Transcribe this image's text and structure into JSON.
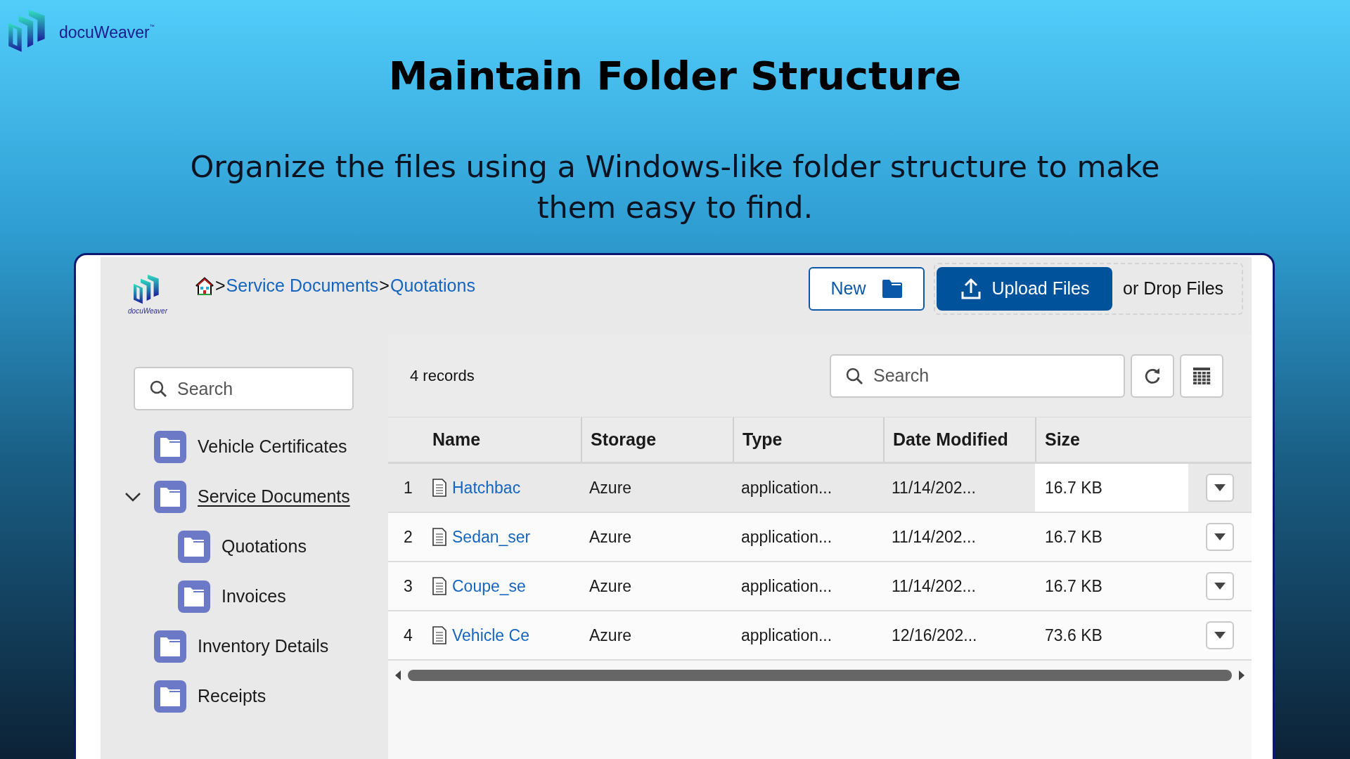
{
  "brand": {
    "name": "docuWeaver",
    "mark": "™"
  },
  "headline": "Maintain Folder Structure",
  "subheadline": "Organize the files using a Windows-like folder structure to make them easy to find.",
  "app": {
    "logo_text": "docuWeaver",
    "breadcrumb": [
      {
        "label": "Service Documents"
      },
      {
        "label": "Quotations"
      }
    ],
    "breadcrumb_separator": ">",
    "new_button": "New",
    "upload_button": "Upload Files",
    "drop_hint": "or Drop Files",
    "tree_search": {
      "placeholder": "Search"
    },
    "tree": [
      {
        "label": "Vehicle Certificates",
        "selected": false
      },
      {
        "label": "Service Documents",
        "selected": true,
        "expanded": true,
        "children": [
          {
            "label": "Quotations",
            "selected": false
          },
          {
            "label": "Invoices",
            "selected": false
          }
        ]
      },
      {
        "label": "Inventory Details",
        "selected": false
      },
      {
        "label": "Receipts",
        "selected": false
      }
    ],
    "record_count": "4 records",
    "table_search": {
      "placeholder": "Search"
    },
    "table": {
      "columns": [
        "Name",
        "Storage",
        "Type",
        "Date Modified",
        "Size"
      ],
      "rows": [
        {
          "index": "1",
          "name": "Hatchbac",
          "storage": "Azure",
          "type": "application...",
          "date": "11/14/202...",
          "size": "16.7 KB",
          "selected": true
        },
        {
          "index": "2",
          "name": "Sedan_ser",
          "storage": "Azure",
          "type": "application...",
          "date": "11/14/202...",
          "size": "16.7 KB",
          "selected": false
        },
        {
          "index": "3",
          "name": "Coupe_se",
          "storage": "Azure",
          "type": "application...",
          "date": "11/14/202...",
          "size": "16.7 KB",
          "selected": false
        },
        {
          "index": "4",
          "name": "Vehicle Ce",
          "storage": "Azure",
          "type": "application...",
          "date": "12/16/202...",
          "size": "73.6 KB",
          "selected": false
        }
      ]
    }
  }
}
